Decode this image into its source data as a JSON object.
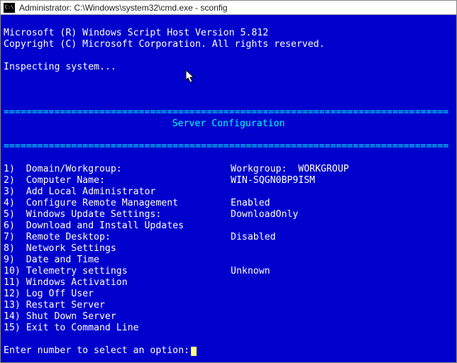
{
  "titlebar": {
    "text": "Administrator: C:\\Windows\\system32\\cmd.exe - sconfig"
  },
  "header": {
    "line1": "Microsoft (R) Windows Script Host Version 5.812",
    "line2": "Copyright (C) Microsoft Corporation. All rights reserved.",
    "inspect": "Inspecting system..."
  },
  "divider": "===============================================================================",
  "section_title": "Server Configuration",
  "menu": [
    {
      "num": "1)",
      "label": "Domain/Workgroup:",
      "value": "Workgroup:  WORKGROUP"
    },
    {
      "num": "2)",
      "label": "Computer Name:",
      "value": "WIN-SQGN0BP9ISM"
    },
    {
      "num": "3)",
      "label": "Add Local Administrator",
      "value": ""
    },
    {
      "num": "4)",
      "label": "Configure Remote Management",
      "value": "Enabled"
    },
    {
      "num": "",
      "label": "",
      "value": ""
    },
    {
      "num": "5)",
      "label": "Windows Update Settings:",
      "value": "DownloadOnly"
    },
    {
      "num": "6)",
      "label": "Download and Install Updates",
      "value": ""
    },
    {
      "num": "7)",
      "label": "Remote Desktop:",
      "value": "Disabled"
    },
    {
      "num": "",
      "label": "",
      "value": ""
    },
    {
      "num": "8)",
      "label": "Network Settings",
      "value": ""
    },
    {
      "num": "9)",
      "label": "Date and Time",
      "value": ""
    },
    {
      "num": "10)",
      "label": "Telemetry settings",
      "value": "Unknown"
    },
    {
      "num": "11)",
      "label": "Windows Activation",
      "value": ""
    },
    {
      "num": "",
      "label": "",
      "value": ""
    },
    {
      "num": "12)",
      "label": "Log Off User",
      "value": ""
    },
    {
      "num": "13)",
      "label": "Restart Server",
      "value": ""
    },
    {
      "num": "14)",
      "label": "Shut Down Server",
      "value": ""
    },
    {
      "num": "15)",
      "label": "Exit to Command Line",
      "value": ""
    }
  ],
  "prompt": "Enter number to select an option:"
}
